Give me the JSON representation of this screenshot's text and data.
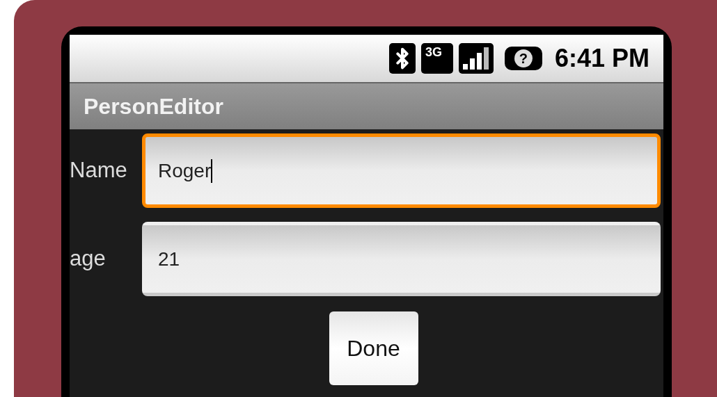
{
  "status_bar": {
    "network": "3G",
    "sim": "?",
    "time": "6:41 PM"
  },
  "title": "PersonEditor",
  "fields": [
    {
      "label": "Name",
      "value": "Roger",
      "focused": true
    },
    {
      "label": "age",
      "value": "21",
      "focused": false
    }
  ],
  "button": "Done"
}
